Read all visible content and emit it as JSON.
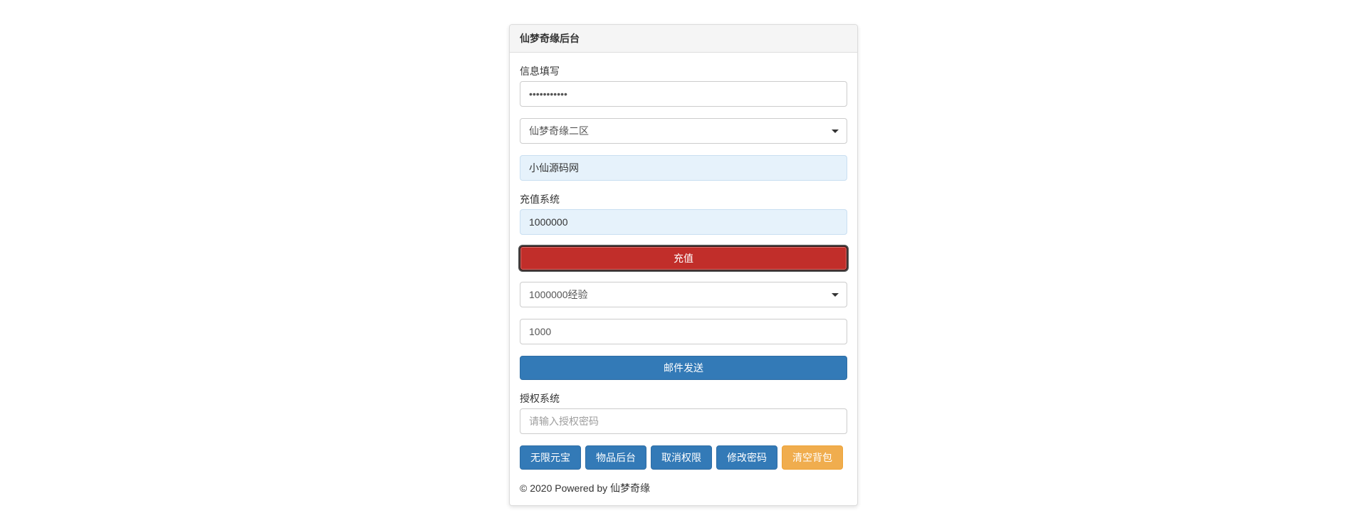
{
  "panel": {
    "title": "仙梦奇缘后台"
  },
  "info": {
    "label": "信息填写",
    "password_value": "•••••••••••",
    "server_selected": "仙梦奇缘二区",
    "user_value": "小仙源码网"
  },
  "recharge": {
    "label": "充值系统",
    "amount_value": "1000000",
    "button": "充值"
  },
  "mail": {
    "item_selected": "1000000经验",
    "qty_value": "1000",
    "button": "邮件发送"
  },
  "auth": {
    "label": "授权系统",
    "placeholder": "请输入授权密码"
  },
  "buttons": {
    "infinite_gold": "无限元宝",
    "item_admin": "物品后台",
    "revoke_auth": "取消权限",
    "change_pw": "修改密码",
    "clear_bag": "清空背包"
  },
  "footer": "© 2020 Powered by 仙梦奇缘"
}
